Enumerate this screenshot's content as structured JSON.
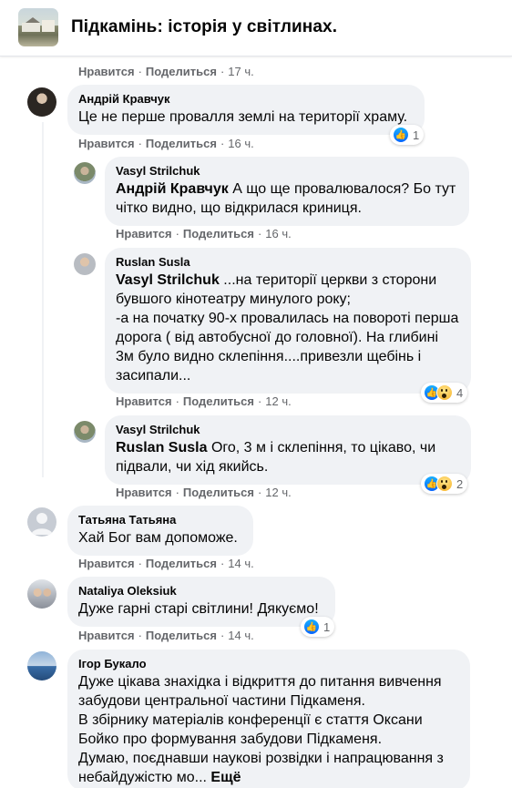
{
  "group": {
    "title": "Підкамінь: історія у світлинах."
  },
  "labels": {
    "like": "Нравится",
    "reply": "Поделиться",
    "sep": "·"
  },
  "top_actions": {
    "time": "17 ч."
  },
  "comments": [
    {
      "author": "Андрій Кравчук",
      "mention": "",
      "text": "Це не перше провалля землі на території храму.",
      "time": "16 ч.",
      "reactions": {
        "icons": [
          "like-icon"
        ],
        "count": "1"
      }
    },
    {
      "author": "Vasyl Strilchuk",
      "mention": "Андрій Кравчук",
      "text": "А що ще провалювалося? Бо тут чітко видно, що відкрилася криниця.",
      "time": "16 ч."
    },
    {
      "author": "Ruslan Susla",
      "mention": "Vasyl Strilchuk",
      "text": "...на території церкви з сторони бувшого кінотеатру минулого року;\n-а на початку 90-х провалилась на повороті перша дорога ( від автобусної до головної). На глибині 3м було видно склепіння....привезли щебінь і засипали...",
      "time": "12 ч.",
      "reactions": {
        "icons": [
          "like-icon",
          "wow-icon"
        ],
        "count": "4"
      }
    },
    {
      "author": "Vasyl Strilchuk",
      "mention": "Ruslan Susla",
      "text": "Ого, 3 м і склепіння, то цікаво, чи підвали, чи хід якийсь.",
      "time": "12 ч.",
      "reactions": {
        "icons": [
          "like-icon",
          "wow-icon"
        ],
        "count": "2"
      }
    },
    {
      "author": "Татьяна Татьяна",
      "mention": "",
      "text": "Хай Бог вам допоможе.",
      "time": "14 ч."
    },
    {
      "author": "Nataliya Oleksiuk",
      "mention": "",
      "text": "Дуже гарні старі світлини! Дякуємо!",
      "time": "14 ч.",
      "reactions": {
        "icons": [
          "like-icon"
        ],
        "count": "1"
      }
    },
    {
      "author": "Ігор Букало",
      "mention": "",
      "text": "Дуже цікава знахідка і відкриття до питання вивчення забудови центральної частини Підкаменя.\nВ збірнику матеріалів конференції є стаття Оксани Бойко про формування забудови Підкаменя.\nДумаю, поєднавши наукові розвідки і напрацювання з небайдужістю мо...",
      "more": "Ещё"
    }
  ],
  "colors": {
    "bubble": "#f0f2f5",
    "meta": "#65676b",
    "text": "#050505",
    "like": "#0866ff"
  }
}
